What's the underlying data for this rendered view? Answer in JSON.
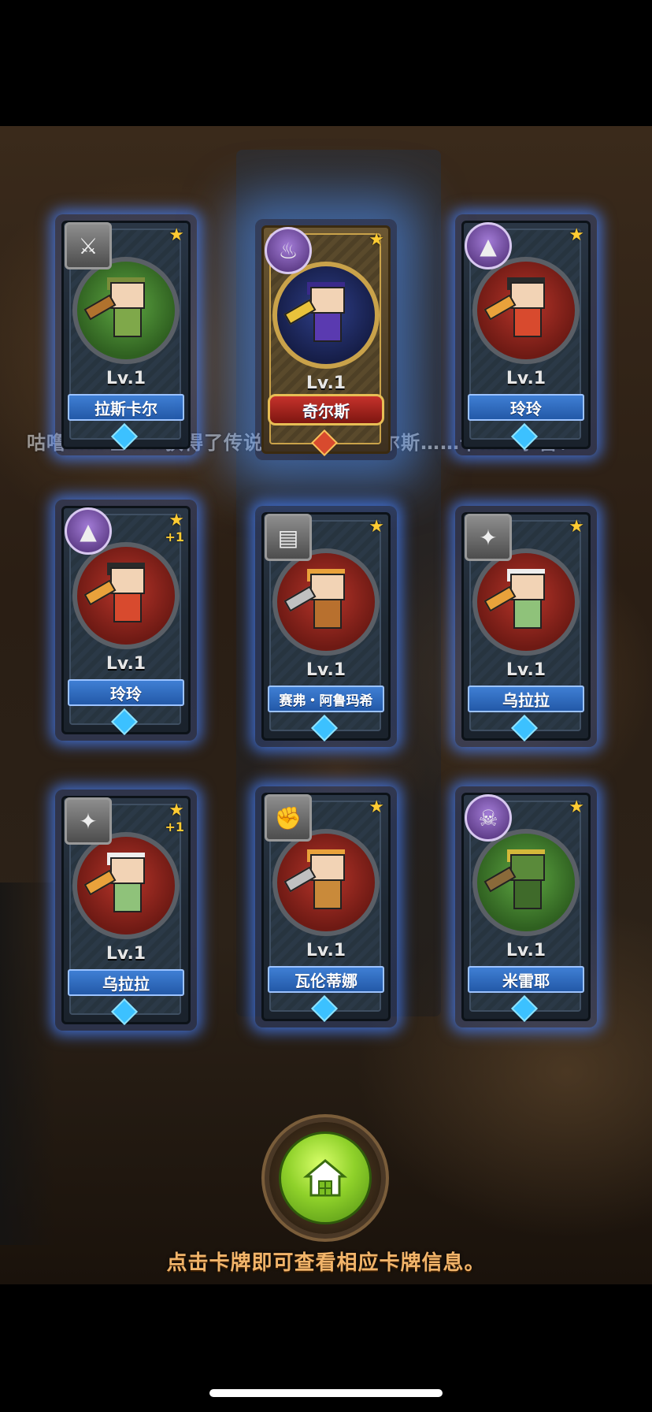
{
  "marquee_text": "咕噜……哇……获得了传说……是……奇尔斯……卡……恭喜！",
  "cards": [
    {
      "level": "Lv.1",
      "name": "拉斯卡尔",
      "class_icon": "shield-crossed-swords-icon",
      "portrait": "green",
      "plus": ""
    },
    {
      "level": "Lv.1",
      "name": "奇尔斯",
      "class_icon": "spiral-staff-icon",
      "portrait": "blue",
      "plus": ""
    },
    {
      "level": "Lv.1",
      "name": "玲玲",
      "class_icon": "wizard-hat-icon",
      "portrait": "red",
      "plus": ""
    },
    {
      "level": "Lv.1",
      "name": "玲玲",
      "class_icon": "wizard-hat-icon",
      "portrait": "red",
      "plus": "+1"
    },
    {
      "level": "Lv.1",
      "name": "赛弗・阿鲁玛希",
      "class_icon": "book-icon",
      "portrait": "red",
      "plus": ""
    },
    {
      "level": "Lv.1",
      "name": "乌拉拉",
      "class_icon": "winged-shield-icon",
      "portrait": "red",
      "plus": ""
    },
    {
      "level": "Lv.1",
      "name": "乌拉拉",
      "class_icon": "winged-shield-icon",
      "portrait": "red",
      "plus": "+1"
    },
    {
      "level": "Lv.1",
      "name": "瓦伦蒂娜",
      "class_icon": "fist-icon",
      "portrait": "red",
      "plus": ""
    },
    {
      "level": "Lv.1",
      "name": "米雷耶",
      "class_icon": "skull-icon",
      "portrait": "green",
      "plus": ""
    }
  ],
  "hint": "点击卡牌即可查看相应卡牌信息。",
  "colors": {
    "card_glow": "#4682ff",
    "banner_blue": "#2f6cc0",
    "legend_banner": "#c6322b",
    "home_green": "#8fd12a",
    "hint_text": "#f1b46a"
  }
}
